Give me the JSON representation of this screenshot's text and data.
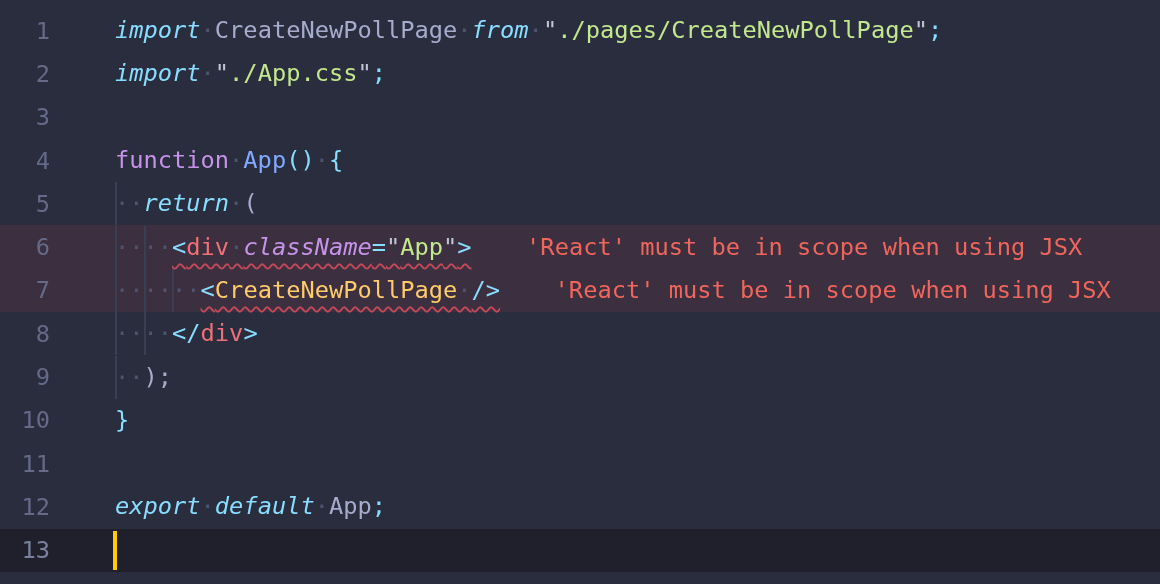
{
  "editor": {
    "lines": [
      {
        "number": "1",
        "current": false,
        "tokens": [
          {
            "kind": "keyword",
            "text": "import"
          },
          {
            "kind": "plain",
            "text": "·CreateNewPollPage·"
          },
          {
            "kind": "keyword",
            "text": "from"
          },
          {
            "kind": "plain",
            "text": "·"
          },
          {
            "kind": "quote",
            "text": "\""
          },
          {
            "kind": "string",
            "text": "./pages/CreateNewPollPage"
          },
          {
            "kind": "quote",
            "text": "\""
          },
          {
            "kind": "punct",
            "text": ";"
          }
        ]
      },
      {
        "number": "2",
        "current": false,
        "tokens": [
          {
            "kind": "keyword",
            "text": "import"
          },
          {
            "kind": "plain",
            "text": "·"
          },
          {
            "kind": "quote",
            "text": "\""
          },
          {
            "kind": "string",
            "text": "./App.css"
          },
          {
            "kind": "quote",
            "text": "\""
          },
          {
            "kind": "punct",
            "text": ";"
          }
        ]
      },
      {
        "number": "3",
        "current": false
      },
      {
        "number": "4",
        "current": false,
        "tokens": [
          {
            "kind": "storage",
            "text": "function"
          },
          {
            "kind": "plain",
            "text": "·"
          },
          {
            "kind": "func",
            "text": "App"
          },
          {
            "kind": "punct",
            "text": "()"
          },
          {
            "kind": "plain",
            "text": "·"
          },
          {
            "kind": "punct",
            "text": "{"
          }
        ]
      },
      {
        "number": "5",
        "current": false,
        "tokens": [
          {
            "kind": "plain",
            "text": "··"
          },
          {
            "kind": "keyword",
            "text": "return"
          },
          {
            "kind": "plain",
            "text": "·("
          }
        ]
      },
      {
        "number": "6",
        "current": false,
        "diagnostic": "'React' must be in scope when using JSX",
        "tokens": [
          {
            "kind": "plain",
            "text": "····"
          },
          {
            "kind": "punct",
            "text": "<"
          },
          {
            "kind": "tag",
            "text": "div"
          },
          {
            "kind": "plain",
            "text": "·"
          },
          {
            "kind": "attr",
            "text": "className"
          },
          {
            "kind": "punct",
            "text": "="
          },
          {
            "kind": "quote",
            "text": "\""
          },
          {
            "kind": "string",
            "text": "App"
          },
          {
            "kind": "quote",
            "text": "\""
          },
          {
            "kind": "punct",
            "text": ">"
          }
        ]
      },
      {
        "number": "7",
        "current": false,
        "diagnostic": "'React' must be in scope when using JSX",
        "tokens": [
          {
            "kind": "plain",
            "text": "······"
          },
          {
            "kind": "punct",
            "text": "<"
          },
          {
            "kind": "component",
            "text": "CreateNewPollPage"
          },
          {
            "kind": "plain",
            "text": "·"
          },
          {
            "kind": "punct",
            "text": "/>"
          }
        ]
      },
      {
        "number": "8",
        "current": false,
        "tokens": [
          {
            "kind": "plain",
            "text": "····"
          },
          {
            "kind": "punct",
            "text": "</"
          },
          {
            "kind": "tag",
            "text": "div"
          },
          {
            "kind": "punct",
            "text": ">"
          }
        ]
      },
      {
        "number": "9",
        "current": false,
        "tokens": [
          {
            "kind": "plain",
            "text": "··);"
          }
        ]
      },
      {
        "number": "10",
        "current": false,
        "tokens": [
          {
            "kind": "punct",
            "text": "}"
          }
        ]
      },
      {
        "number": "11",
        "current": false
      },
      {
        "number": "12",
        "current": false,
        "tokens": [
          {
            "kind": "keyword",
            "text": "export"
          },
          {
            "kind": "plain",
            "text": "·"
          },
          {
            "kind": "keyword",
            "text": "default"
          },
          {
            "kind": "plain",
            "text": "·App"
          },
          {
            "kind": "punct",
            "text": ";"
          }
        ]
      },
      {
        "number": "13",
        "current": true
      }
    ]
  }
}
